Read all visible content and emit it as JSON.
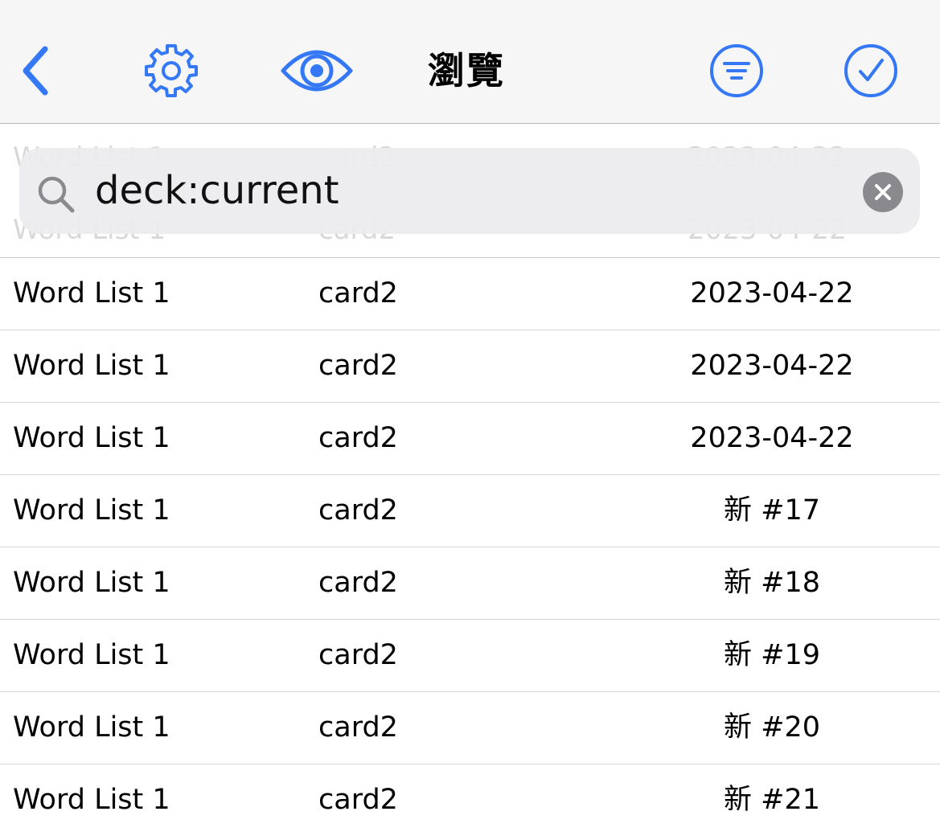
{
  "navbar": {
    "title": "瀏覽",
    "icons": {
      "back": "chevron-left-icon",
      "settings": "gear-icon",
      "preview": "eye-icon",
      "filter": "filter-lines-icon",
      "select": "checkmark-circle-icon"
    },
    "accent_color": "#3478f6"
  },
  "search": {
    "value": "deck:current",
    "icons": {
      "search": "magnifier-icon",
      "clear": "clear-x-circle-icon"
    }
  },
  "ghost_rows": [
    {
      "deck": "Word List 1",
      "card": "card2",
      "due": "2023-04-22"
    },
    {
      "deck": "Word List 1",
      "card": "card2",
      "due": "2023-04-22"
    }
  ],
  "rows": [
    {
      "deck": "Word List 1",
      "card": "card2",
      "due": "2023-04-22"
    },
    {
      "deck": "Word List 1",
      "card": "card2",
      "due": "2023-04-22"
    },
    {
      "deck": "Word List 1",
      "card": "card2",
      "due": "2023-04-22"
    },
    {
      "deck": "Word List 1",
      "card": "card2",
      "due": "新 #17"
    },
    {
      "deck": "Word List 1",
      "card": "card2",
      "due": "新 #18"
    },
    {
      "deck": "Word List 1",
      "card": "card2",
      "due": "新 #19"
    },
    {
      "deck": "Word List 1",
      "card": "card2",
      "due": "新 #20"
    },
    {
      "deck": "Word List 1",
      "card": "card2",
      "due": "新 #21"
    }
  ]
}
